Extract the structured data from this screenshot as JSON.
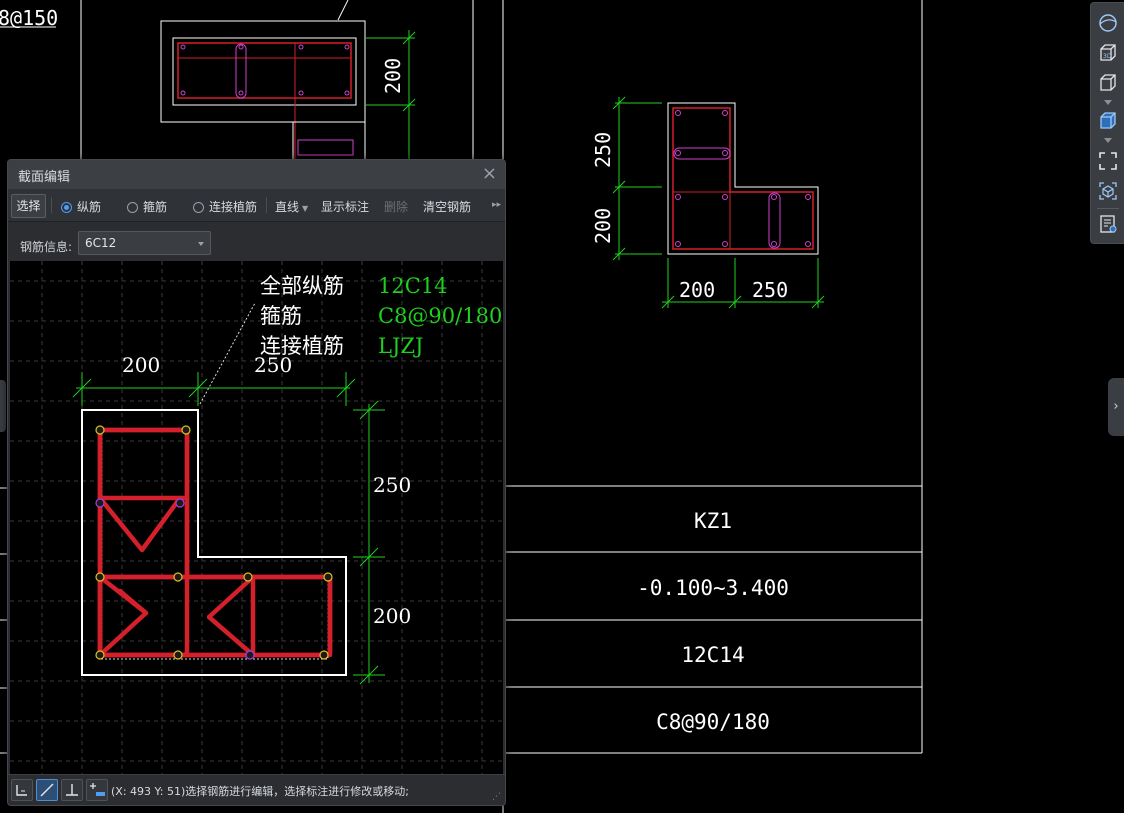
{
  "background_drawing": {
    "corner_label": "8@150",
    "detail_dims": {
      "vertical": "200"
    },
    "section": {
      "dim_left_top": "250",
      "dim_left_bottom": "200",
      "dim_bottom_left": "200",
      "dim_bottom_right": "250"
    },
    "table": [
      "KZ1",
      "-0.100~3.400",
      "12C14",
      "C8@90/180"
    ]
  },
  "dialog": {
    "title": "截面编辑",
    "toolbar": {
      "select": "选择",
      "longitudinal": "纵筋",
      "stirrup": "箍筋",
      "connect_bar": "连接植筋",
      "line_mode": "直线",
      "show_annotation": "显示标注",
      "delete": "删除",
      "clear_rebar": "清空钢筋"
    },
    "rebar_info_label": "钢筋信息:",
    "rebar_info_value": "6C12",
    "canvas": {
      "label_all_long": "全部纵筋",
      "value_all_long": "12C14",
      "label_stirrup": "箍筋",
      "value_stirrup": "C8@90/180",
      "label_connect": "连接植筋",
      "value_connect": "LJZJ",
      "dim_top_left": "200",
      "dim_top_right": "250",
      "dim_right_top": "250",
      "dim_right_bottom": "200"
    },
    "status_text": "(X: 493 Y: 51)选择钢筋进行编辑，选择标注进行修改或移动;"
  },
  "colors": {
    "rebar_red": "#d4202a",
    "dim_green": "#1fd01f",
    "outline_white": "#ffffff",
    "stirrup_magenta": "#d040d0",
    "accent_blue": "#4d9cf5"
  }
}
